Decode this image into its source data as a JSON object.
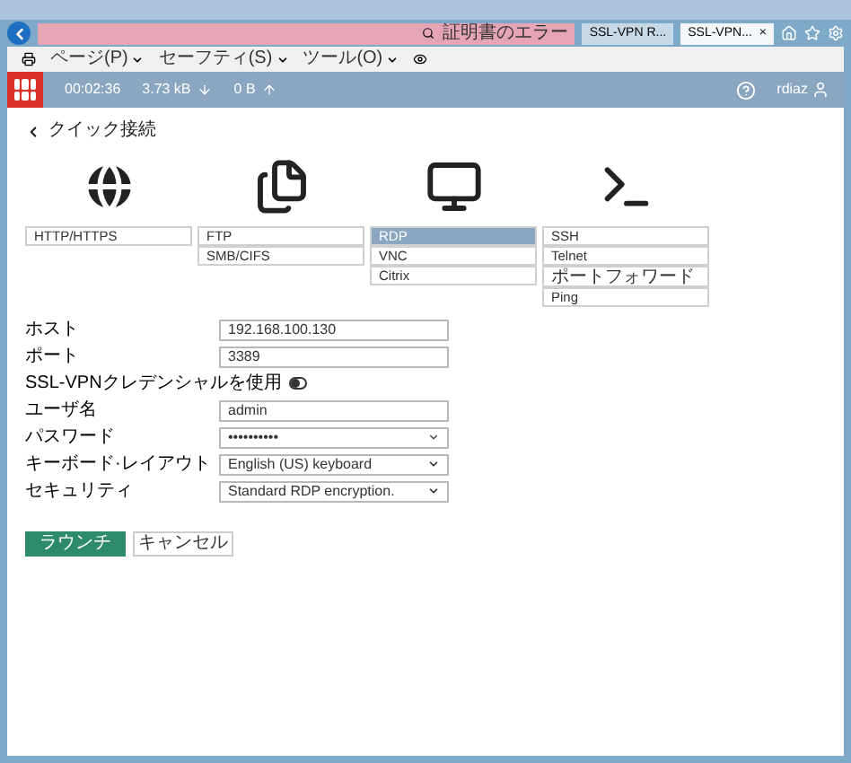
{
  "browser": {
    "address_status": "証明書のエラー",
    "tabs": [
      {
        "title": "SSL-VPN R...",
        "selected": false
      },
      {
        "title": "SSL-VPN...",
        "selected": true,
        "close": "×"
      }
    ],
    "menu": [
      "ページ(P)",
      "セーフティ(S)",
      "ツール(O)"
    ]
  },
  "header": {
    "time": "00:02:36",
    "received": "3.73 kB",
    "sent": "0 B",
    "user": "rdiaz"
  },
  "back": {
    "label": "クイック接続"
  },
  "categories": [
    {
      "kind": "globe",
      "items": [
        {
          "label": "HTTP/HTTPS",
          "selected": false
        }
      ]
    },
    {
      "kind": "files",
      "items": [
        {
          "label": "FTP",
          "selected": false
        },
        {
          "label": "SMB/CIFS",
          "selected": false
        }
      ]
    },
    {
      "kind": "monitor",
      "items": [
        {
          "label": "RDP",
          "selected": true
        },
        {
          "label": "VNC",
          "selected": false
        },
        {
          "label": "Citrix",
          "selected": false
        }
      ]
    },
    {
      "kind": "terminal",
      "items": [
        {
          "label": "SSH",
          "selected": false
        },
        {
          "label": "Telnet",
          "selected": false
        },
        {
          "label": "ポートフォワード",
          "selected": false
        },
        {
          "label": "Ping",
          "selected": false
        }
      ]
    }
  ],
  "form": [
    {
      "kind": "text",
      "label": "ホスト",
      "value": "192.168.100.130"
    },
    {
      "kind": "text",
      "label": "ポート",
      "value": "3389"
    },
    {
      "kind": "toggle",
      "label": "SSL-VPNクレデンシャルを使用",
      "on": false
    },
    {
      "kind": "text",
      "label": "ユーザ名",
      "value": "admin"
    },
    {
      "kind": "password",
      "label": "パスワード",
      "value": "••••••••••"
    },
    {
      "kind": "select",
      "label": "キーボード·レイアウト",
      "value": "English (US) keyboard"
    },
    {
      "kind": "select",
      "label": "セキュリティ",
      "value": "Standard RDP encryption."
    }
  ],
  "buttons": [
    {
      "label": "ラウンチ",
      "kind": "primary"
    },
    {
      "label": "キャンセル",
      "kind": "secondary"
    }
  ]
}
